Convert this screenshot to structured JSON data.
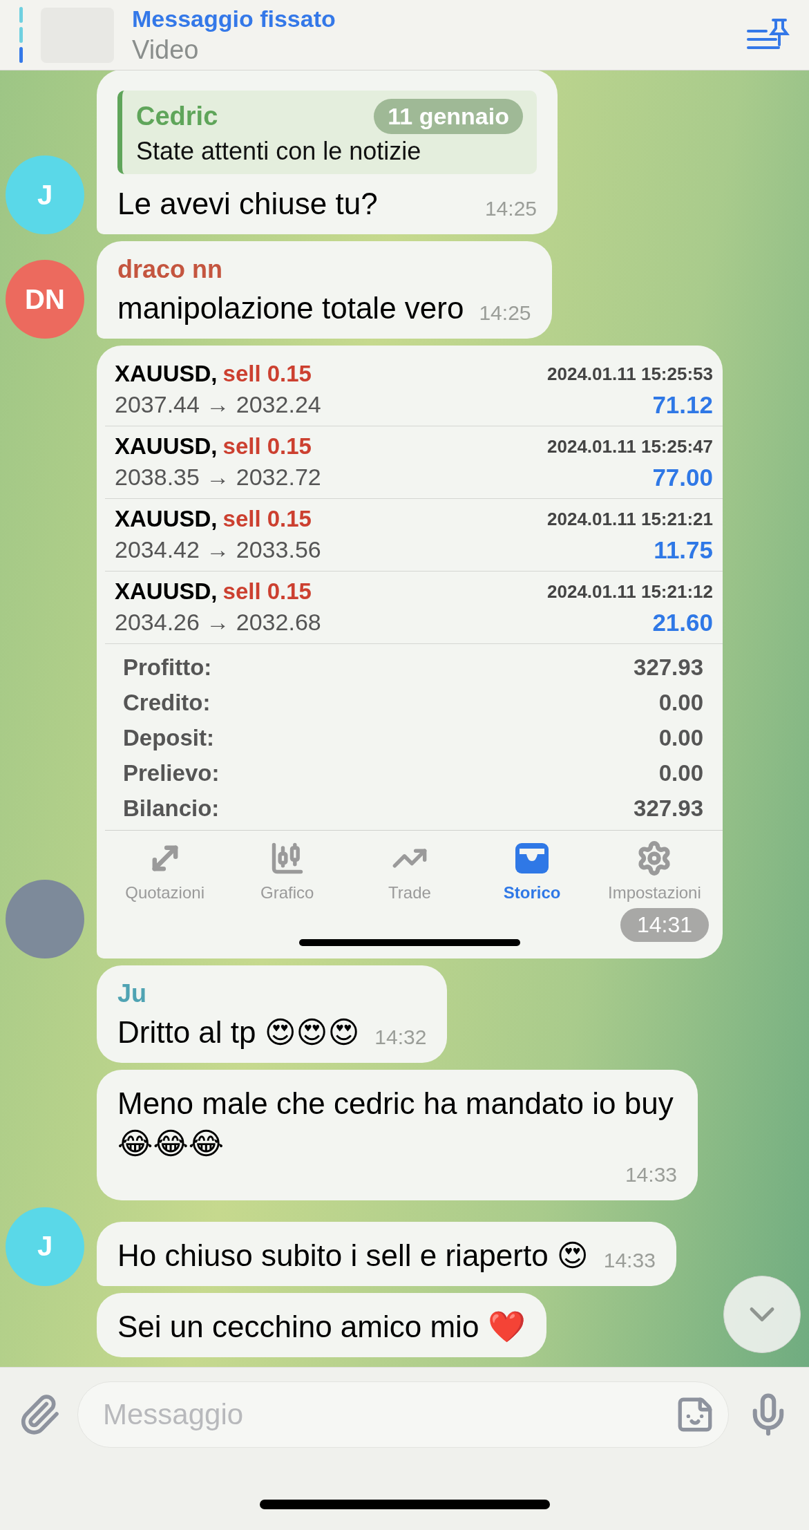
{
  "pinned": {
    "title": "Messaggio fissato",
    "subtitle": "Video"
  },
  "date_badge": "11 gennaio",
  "messages": [
    {
      "kind": "reply",
      "reply": {
        "author": "Cedric",
        "text": "State attenti con le notizie"
      },
      "text": "Le avevi chiuse tu?",
      "time": "14:25",
      "avatar": {
        "kind": "initials",
        "initials": "J",
        "color": "#5ad8e8"
      }
    },
    {
      "kind": "text",
      "sender": {
        "name": "draco nn",
        "color": "#c4553f"
      },
      "text": "manipolazione totale vero",
      "time": "14:25",
      "avatar": {
        "kind": "initials",
        "initials": "DN",
        "color": "#ec6a5e"
      }
    },
    {
      "kind": "screenshot",
      "trades": [
        {
          "symbol": "XAUUSD,",
          "side": "sell 0.15",
          "date": "2024.01.11 15:25:53",
          "prices": "2037.44 → 2032.24",
          "profit": "71.12"
        },
        {
          "symbol": "XAUUSD,",
          "side": "sell 0.15",
          "date": "2024.01.11 15:25:47",
          "prices": "2038.35 → 2032.72",
          "profit": "77.00"
        },
        {
          "symbol": "XAUUSD,",
          "side": "sell 0.15",
          "date": "2024.01.11 15:21:21",
          "prices": "2034.42 → 2033.56",
          "profit": "11.75"
        },
        {
          "symbol": "XAUUSD,",
          "side": "sell 0.15",
          "date": "2024.01.11 15:21:12",
          "prices": "2034.26 → 2032.68",
          "profit": "21.60"
        }
      ],
      "summary": [
        {
          "label": "Profitto:",
          "value": "327.93"
        },
        {
          "label": "Credito:",
          "value": "0.00"
        },
        {
          "label": "Deposit:",
          "value": "0.00"
        },
        {
          "label": "Prelievo:",
          "value": "0.00"
        },
        {
          "label": "Bilancio:",
          "value": "327.93"
        }
      ],
      "tabs": [
        {
          "label": "Quotazioni",
          "selected": false
        },
        {
          "label": "Grafico",
          "selected": false
        },
        {
          "label": "Trade",
          "selected": false
        },
        {
          "label": "Storico",
          "selected": true
        },
        {
          "label": "Impostazioni",
          "selected": false
        }
      ],
      "time": "14:31",
      "avatar": {
        "kind": "photo"
      }
    },
    {
      "kind": "text",
      "sender": {
        "name": "Ju",
        "color": "#4fa3b3"
      },
      "text": "Dritto al tp 😍😍😍",
      "time": "14:32"
    },
    {
      "kind": "text",
      "text": "Meno male che cedric ha mandato io buy 😂😂😂",
      "time": "14:33"
    },
    {
      "kind": "text",
      "text": "Ho chiuso subito i sell e riaperto 😍",
      "time": "14:33",
      "avatar": {
        "kind": "initials",
        "initials": "J",
        "color": "#5ad8e8"
      }
    },
    {
      "kind": "text",
      "text": "Sei un cecchino amico mio ❤️"
    }
  ],
  "input": {
    "placeholder": "Messaggio"
  }
}
